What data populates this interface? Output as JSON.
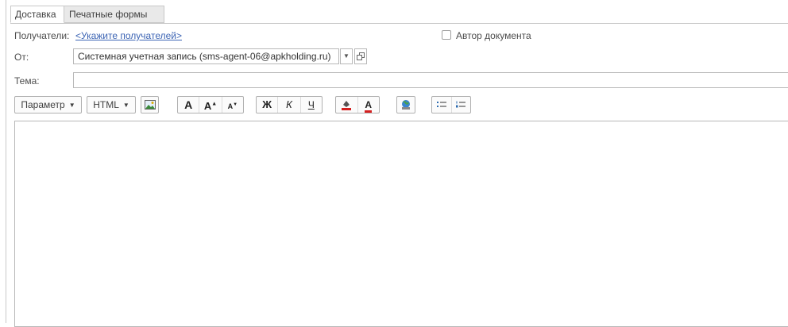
{
  "tabs": [
    {
      "label": "Доставка",
      "active": true
    },
    {
      "label": "Печатные формы",
      "active": false
    }
  ],
  "recipients": {
    "label": "Получатели:",
    "link": "<Укажите получателей>"
  },
  "author_checkbox": {
    "label": "Автор документа",
    "checked": false
  },
  "from": {
    "label": "От:",
    "value": "Системная учетная запись (sms-agent-06@apkholding.ru)",
    "dropdown_icon": "caret-down-icon",
    "open_icon": "open-window-icon"
  },
  "subject": {
    "label": "Тема:",
    "value": ""
  },
  "toolbar": {
    "param_label": "Параметр",
    "html_label": "HTML",
    "font_a": "A",
    "bold": "Ж",
    "italic": "К",
    "underline": "Ч",
    "icons": [
      "insert-image-icon",
      "font-icon",
      "font-increase-icon",
      "font-decrease-icon",
      "bold-icon",
      "italic-icon",
      "underline-icon",
      "background-color-icon",
      "text-color-icon",
      "insert-link-icon",
      "bullet-list-icon",
      "numbered-list-icon"
    ]
  },
  "editor": {
    "content": ""
  },
  "colors": {
    "link": "#3c64b4",
    "accent_red": "#d42020",
    "border": "#b8b8b8"
  }
}
